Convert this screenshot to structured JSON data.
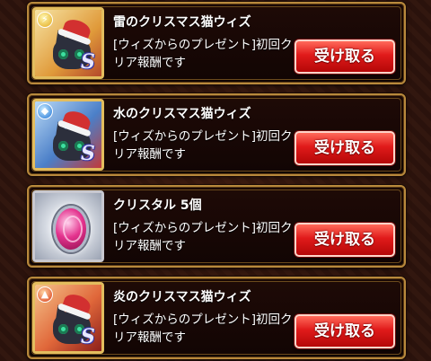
{
  "rewards": [
    {
      "title": "雷のクリスマス猫ウィズ",
      "description": "[ウィズからのプレゼント]初回クリア報酬です",
      "button": "受け取る",
      "icon": "thunder-christmas-cat-icon",
      "rarity": "S",
      "element_color": "#e2a81a"
    },
    {
      "title": "水のクリスマス猫ウィズ",
      "description": "[ウィズからのプレゼント]初回クリア報酬です",
      "button": "受け取る",
      "icon": "water-christmas-cat-icon",
      "rarity": "S",
      "element_color": "#1f73d6"
    },
    {
      "title": "クリスタル 5個",
      "description": "[ウィズからのプレゼント]初回クリア報酬です",
      "button": "受け取る",
      "icon": "crystal-gem-icon"
    },
    {
      "title": "炎のクリスマス猫ウィズ",
      "description": "[ウィズからのプレゼント]初回クリア報酬です",
      "button": "受け取る",
      "icon": "fire-christmas-cat-icon",
      "rarity": "S",
      "element_color": "#d83a16"
    }
  ]
}
